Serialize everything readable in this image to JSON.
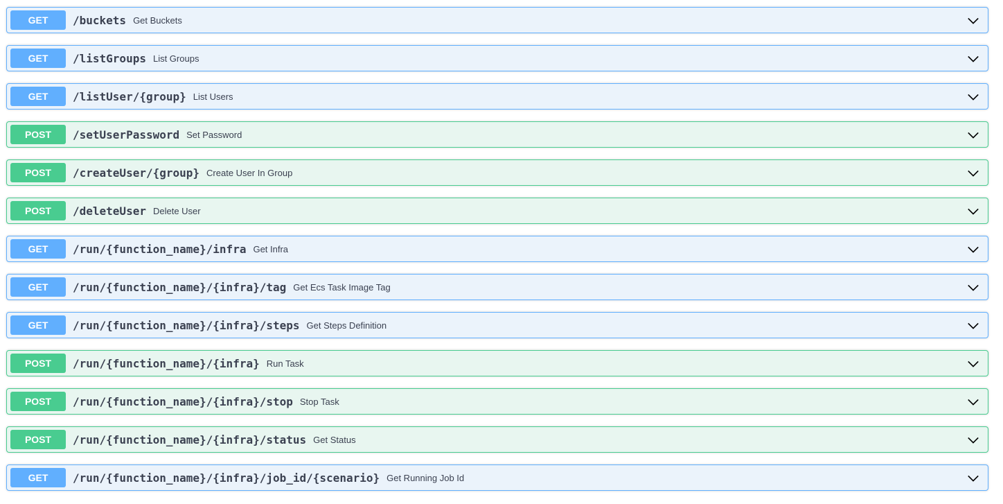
{
  "operations": [
    {
      "method": "GET",
      "path": "/buckets",
      "summary": "Get Buckets"
    },
    {
      "method": "GET",
      "path": "/listGroups",
      "summary": "List Groups"
    },
    {
      "method": "GET",
      "path": "/listUser/{group}",
      "summary": "List Users"
    },
    {
      "method": "POST",
      "path": "/setUserPassword",
      "summary": "Set Password"
    },
    {
      "method": "POST",
      "path": "/createUser/{group}",
      "summary": "Create User In Group"
    },
    {
      "method": "POST",
      "path": "/deleteUser",
      "summary": "Delete User"
    },
    {
      "method": "GET",
      "path": "/run/{function_name}/infra",
      "summary": "Get Infra"
    },
    {
      "method": "GET",
      "path": "/run/{function_name}/{infra}/tag",
      "summary": "Get Ecs Task Image Tag"
    },
    {
      "method": "GET",
      "path": "/run/{function_name}/{infra}/steps",
      "summary": "Get Steps Definition"
    },
    {
      "method": "POST",
      "path": "/run/{function_name}/{infra}",
      "summary": "Run Task"
    },
    {
      "method": "POST",
      "path": "/run/{function_name}/{infra}/stop",
      "summary": "Stop Task"
    },
    {
      "method": "POST",
      "path": "/run/{function_name}/{infra}/status",
      "summary": "Get Status"
    },
    {
      "method": "GET",
      "path": "/run/{function_name}/{infra}/job_id/{scenario}",
      "summary": "Get Running Job Id"
    }
  ],
  "icons": {
    "expand": "chevron-down-icon"
  },
  "colors": {
    "get_accent": "#61affe",
    "get_background": "#ebf3fb",
    "post_accent": "#49cc90",
    "post_background": "#e8f6f0",
    "text": "#3b4151"
  }
}
